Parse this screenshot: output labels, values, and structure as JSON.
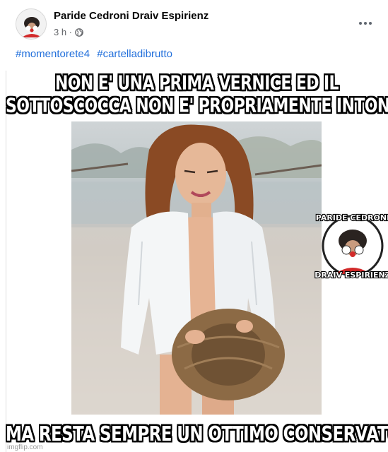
{
  "post": {
    "author": "Paride Cedroni Draiv Espirienz",
    "time": "3 h ·",
    "privacy_icon": "globe-icon",
    "more_icon": "more-options-icon",
    "hashtags": [
      "#momentorete4",
      "#cartelladibrutto"
    ]
  },
  "image": {
    "top_line_1": "NON E' UNA PRIMA VERNICE ED IL",
    "top_line_2": "SOTTOSCOCCA NON E' PROPRIAMENTE INTONSO",
    "bottom_line": "MA RESTA SEMPRE UN OTTIMO CONSERVATO",
    "watermark_top": "PARIDE CEDRONI",
    "watermark_bottom": "DRAIV ESPIRIENZ",
    "source": "imgflip.com"
  },
  "colors": {
    "link": "#216fdb",
    "meta": "#65676b",
    "text": "#050505"
  }
}
